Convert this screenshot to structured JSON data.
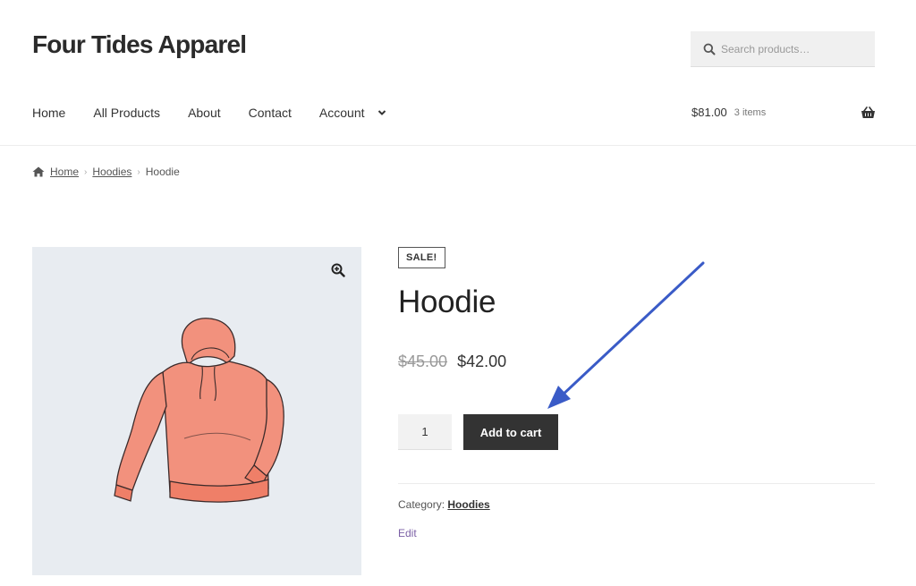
{
  "site": {
    "title": "Four Tides Apparel"
  },
  "search": {
    "placeholder": "Search products…",
    "icon": "search-icon"
  },
  "nav": {
    "items": [
      {
        "label": "Home"
      },
      {
        "label": "All Products"
      },
      {
        "label": "About"
      },
      {
        "label": "Contact"
      },
      {
        "label": "Account",
        "has_dropdown": true
      }
    ]
  },
  "cart": {
    "total": "$81.00",
    "count": "3 items",
    "icon": "basket-icon"
  },
  "breadcrumb": {
    "items": [
      {
        "label": "Home",
        "link": true
      },
      {
        "label": "Hoodies",
        "link": true
      },
      {
        "label": "Hoodie",
        "link": false
      }
    ]
  },
  "product": {
    "badge": "SALE!",
    "title": "Hoodie",
    "price_old": "$45.00",
    "price_new": "$42.00",
    "quantity": "1",
    "add_to_cart": "Add to cart",
    "category_label": "Category:",
    "category": "Hoodies",
    "edit_label": "Edit",
    "image_icon": "hoodie-illustration",
    "zoom_icon": "zoom-in-icon"
  },
  "colors": {
    "button_bg": "#333333",
    "gallery_bg": "#e8ecf1",
    "hoodie": "#f2917d",
    "annotation_arrow": "#3a5bc7",
    "edit_link": "#7b5fa5"
  }
}
